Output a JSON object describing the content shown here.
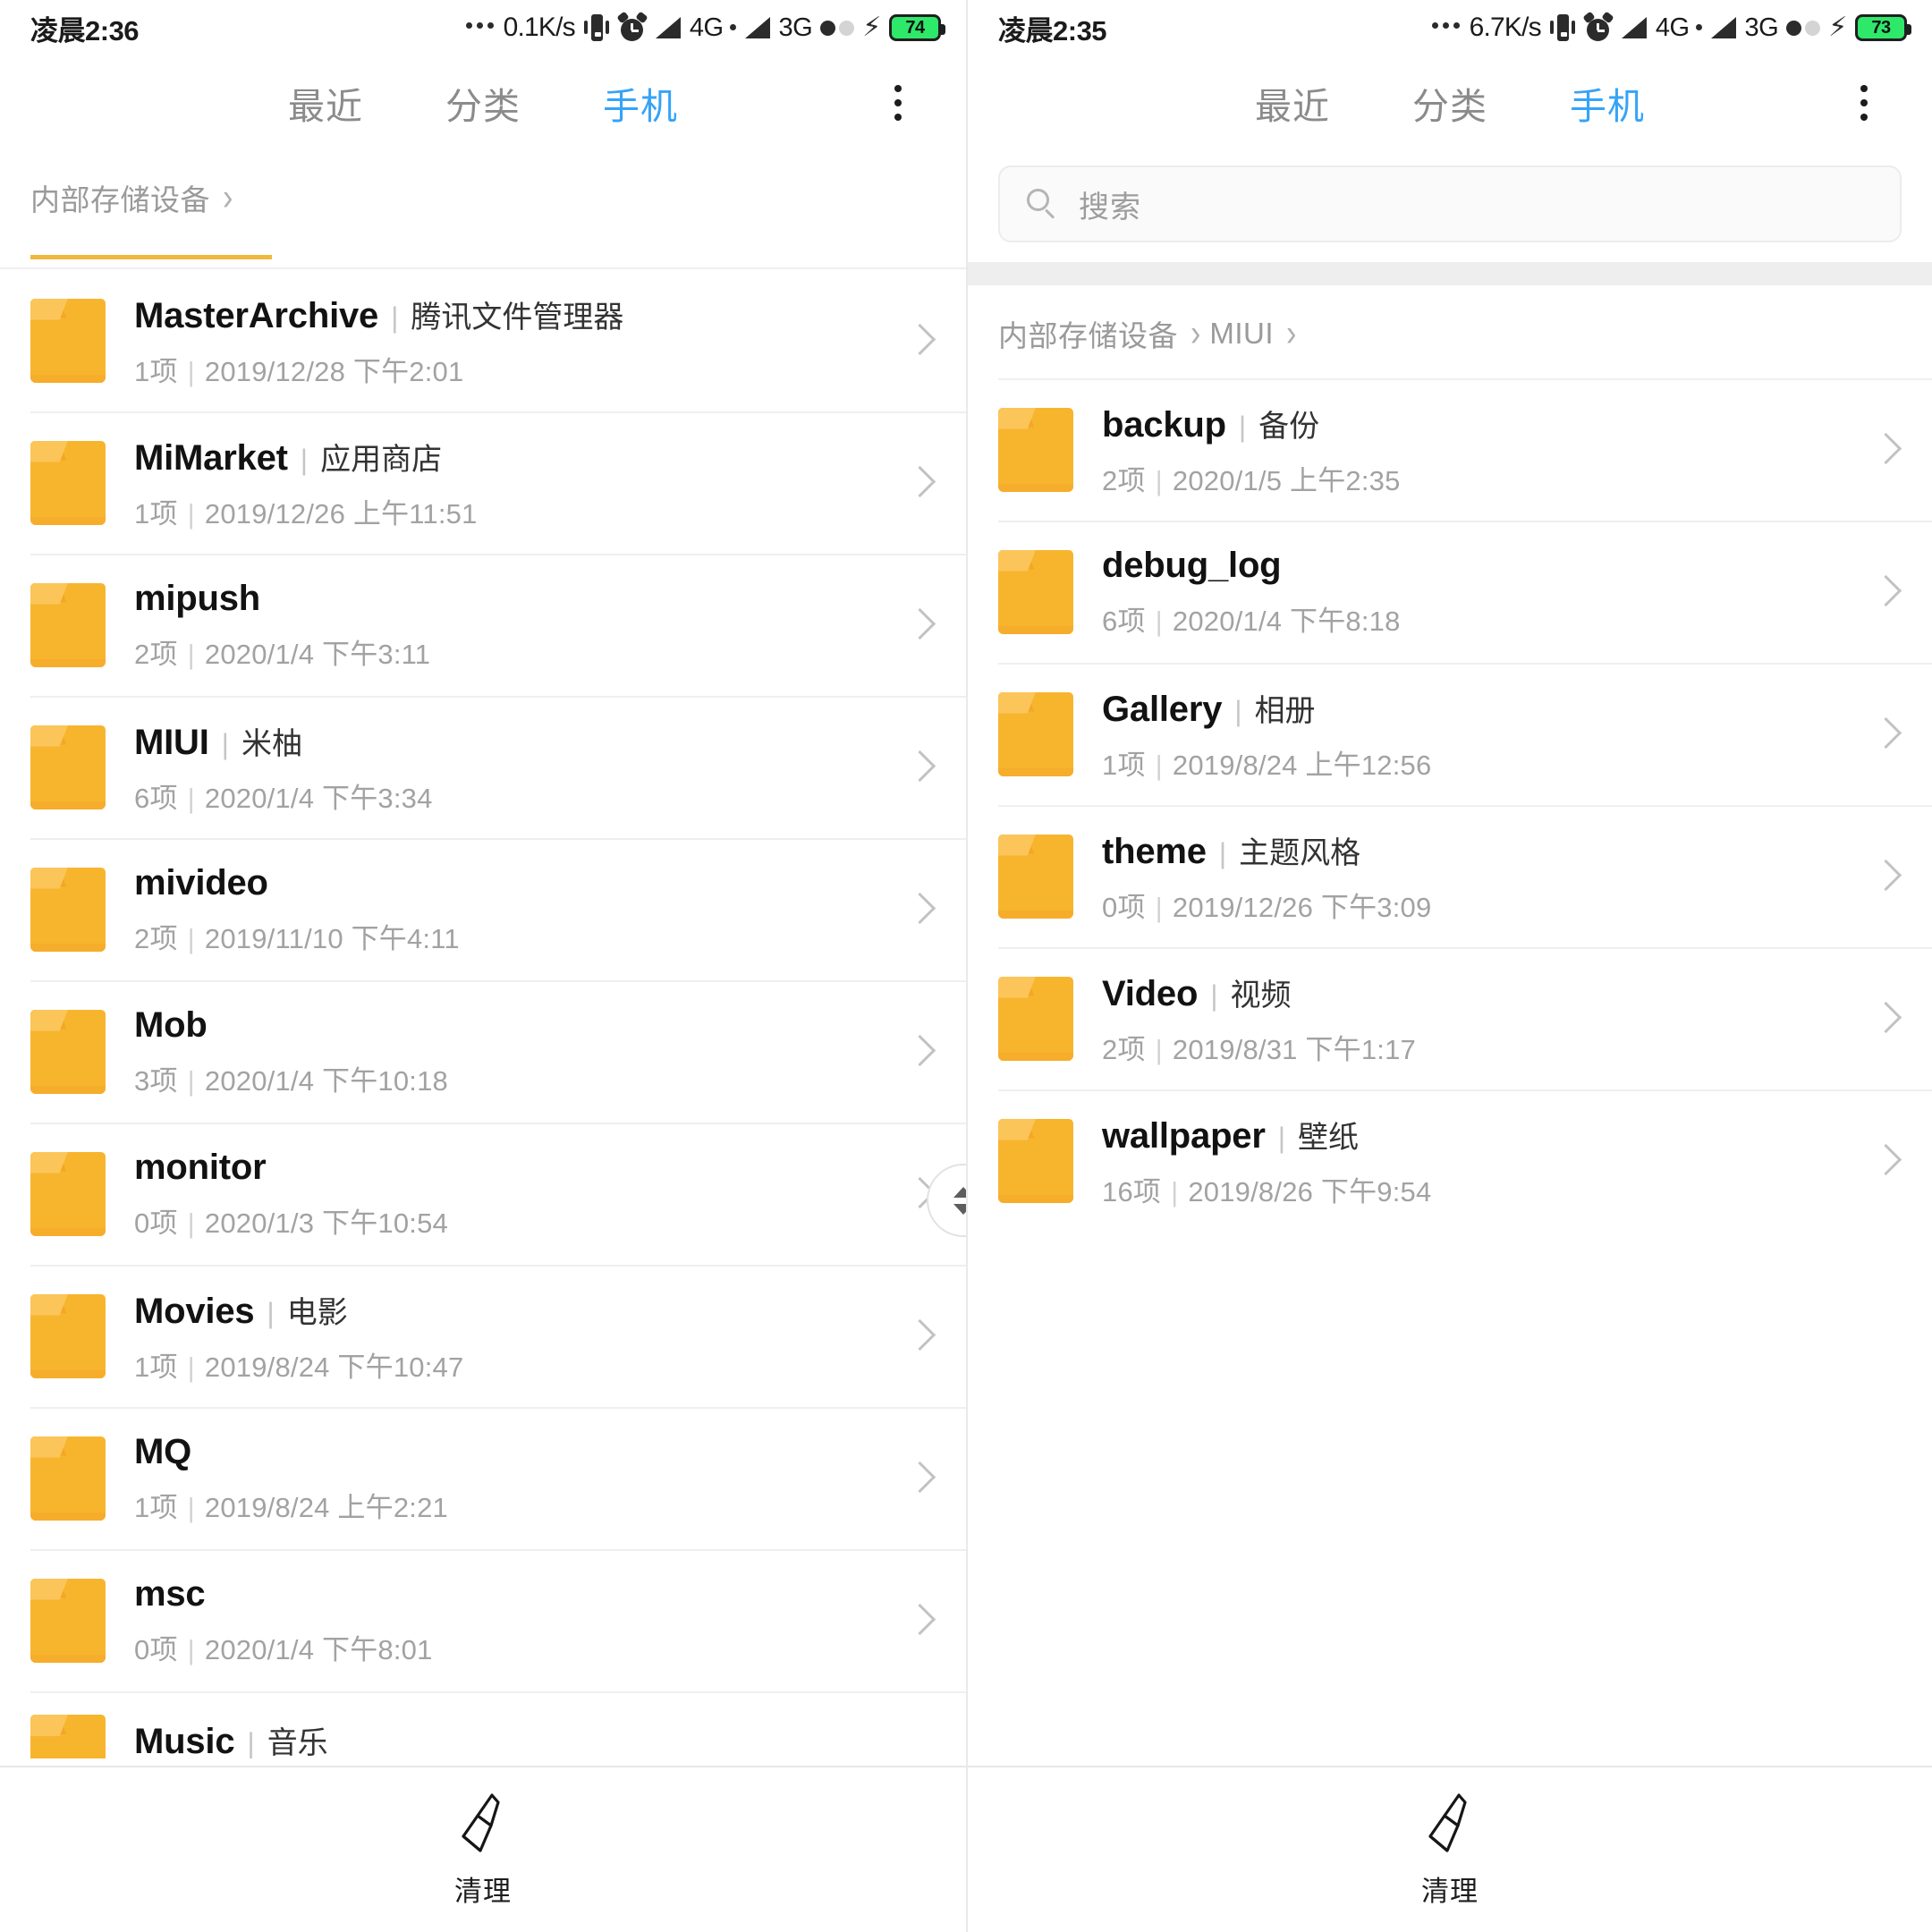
{
  "colors": {
    "accent": "#36a3f7",
    "folder": "#f7b52e",
    "battery": "#2ee86a",
    "muted": "#9a9a9a",
    "divider": "#efefef"
  },
  "panes": [
    {
      "id": "left",
      "status": {
        "clock": "凌晨2:36",
        "speed": "0.1K/s",
        "net_primary": "4G",
        "net_secondary": "3G",
        "battery": "74",
        "icons": [
          "ellipsis-icon",
          "vibrate-icon",
          "alarm-icon",
          "signal-icon",
          "signal-icon",
          "sim-dots-icon",
          "charging-bolt-icon",
          "battery-icon"
        ]
      },
      "tabs": [
        {
          "label": "最近",
          "active": false
        },
        {
          "label": "分类",
          "active": false
        },
        {
          "label": "手机",
          "active": true
        }
      ],
      "overflow_label": "更多",
      "breadcrumb": [
        "内部存储设备"
      ],
      "has_search": false,
      "clipped_top_visible": true,
      "scroll_thumb_visible": true,
      "files": [
        {
          "name": "MasterArchive",
          "alias": "腾讯文件管理器",
          "count": "1项",
          "date": "2019/12/28 下午2:01"
        },
        {
          "name": "MiMarket",
          "alias": "应用商店",
          "count": "1项",
          "date": "2019/12/26 上午11:51"
        },
        {
          "name": "mipush",
          "alias": "",
          "count": "2项",
          "date": "2020/1/4 下午3:11"
        },
        {
          "name": "MIUI",
          "alias": "米柚",
          "count": "6项",
          "date": "2020/1/4 下午3:34"
        },
        {
          "name": "mivideo",
          "alias": "",
          "count": "2项",
          "date": "2019/11/10 下午4:11"
        },
        {
          "name": "Mob",
          "alias": "",
          "count": "3项",
          "date": "2020/1/4 下午10:18"
        },
        {
          "name": "monitor",
          "alias": "",
          "count": "0项",
          "date": "2020/1/3 下午10:54"
        },
        {
          "name": "Movies",
          "alias": "电影",
          "count": "1项",
          "date": "2019/8/24 下午10:47"
        },
        {
          "name": "MQ",
          "alias": "",
          "count": "1项",
          "date": "2019/8/24 上午2:21"
        },
        {
          "name": "msc",
          "alias": "",
          "count": "0项",
          "date": "2020/1/4 下午8:01"
        }
      ],
      "clipped_bottom": {
        "name": "Music",
        "alias": "音乐"
      },
      "bottom": {
        "label": "清理",
        "icon": "broom-icon"
      }
    },
    {
      "id": "right",
      "status": {
        "clock": "凌晨2:35",
        "speed": "6.7K/s",
        "net_primary": "4G",
        "net_secondary": "3G",
        "battery": "73",
        "icons": [
          "ellipsis-icon",
          "vibrate-icon",
          "alarm-icon",
          "signal-icon",
          "signal-icon",
          "sim-dots-icon",
          "charging-bolt-icon",
          "battery-icon"
        ]
      },
      "tabs": [
        {
          "label": "最近",
          "active": false
        },
        {
          "label": "分类",
          "active": false
        },
        {
          "label": "手机",
          "active": true
        }
      ],
      "overflow_label": "更多",
      "search": {
        "placeholder": "搜索",
        "value": ""
      },
      "breadcrumb": [
        "内部存储设备",
        "MIUI"
      ],
      "has_search": true,
      "clipped_top_visible": false,
      "scroll_thumb_visible": false,
      "files": [
        {
          "name": "backup",
          "alias": "备份",
          "count": "2项",
          "date": "2020/1/5 上午2:35"
        },
        {
          "name": "debug_log",
          "alias": "",
          "count": "6项",
          "date": "2020/1/4 下午8:18"
        },
        {
          "name": "Gallery",
          "alias": "相册",
          "count": "1项",
          "date": "2019/8/24 上午12:56"
        },
        {
          "name": "theme",
          "alias": "主题风格",
          "count": "0项",
          "date": "2019/12/26 下午3:09"
        },
        {
          "name": "Video",
          "alias": "视频",
          "count": "2项",
          "date": "2019/8/31 下午1:17"
        },
        {
          "name": "wallpaper",
          "alias": "壁纸",
          "count": "16项",
          "date": "2019/8/26 下午9:54"
        }
      ],
      "clipped_bottom": null,
      "bottom": {
        "label": "清理",
        "icon": "broom-icon"
      }
    }
  ]
}
